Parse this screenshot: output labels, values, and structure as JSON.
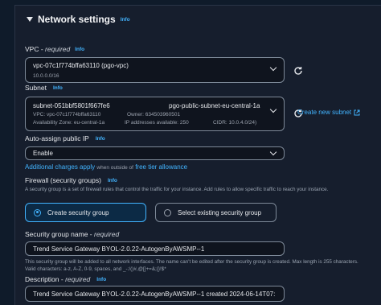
{
  "section": {
    "title": "Network settings",
    "info": "Info"
  },
  "vpc": {
    "label": "VPC",
    "required": "required",
    "info": "Info",
    "value": "vpc-07c1f774bffa63110 (pgo-vpc)",
    "cidr": "10.0.0.0/16"
  },
  "subnet": {
    "label": "Subnet",
    "info": "Info",
    "id": "subnet-051bbf5801f667fe6",
    "name": "pgo-public-subnet-eu-central-1a",
    "vpc_line": "VPC: vpc-07c1f774bffa63110",
    "owner": "Owner: 634503960501",
    "az": "Availability Zone: eu-central-1a",
    "ips": "IP addresses available: 250",
    "cidr": "CIDR: 10.0.4.0/24)",
    "create_link": "Create new subnet"
  },
  "public_ip": {
    "label": "Auto-assign public IP",
    "info": "Info",
    "value": "Enable",
    "charges_link": "Additional charges apply",
    "charges_mid": "when outside of",
    "free_tier_link": "free tier allowance"
  },
  "firewall": {
    "label": "Firewall (security groups)",
    "info": "Info",
    "help": "A security group is a set of firewall rules that control the traffic for your instance. Add rules to allow specific traffic to reach your instance.",
    "option_create": "Create security group",
    "option_existing": "Select existing security group",
    "selected": "create"
  },
  "sg_name": {
    "label": "Security group name",
    "required": "required",
    "value": "Trend Service Gateway BYOL-2.0.22-AutogenByAWSMP--1",
    "help": "This security group will be added to all network interfaces. The name can't be edited after the security group is created. Max length is 255 characters. Valid characters: a-z, A-Z, 0-9, spaces, and _-:/()#,@[]+=&;{}!$*"
  },
  "description": {
    "label": "Description",
    "required": "required",
    "info": "Info",
    "value": "Trend Service Gateway BYOL-2.0.22-AutogenByAWSMP--1 created 2024-06-14T07:"
  },
  "colors": {
    "accent": "#42b4ff",
    "panel": "#161e2d",
    "background": "#0f1b2a"
  }
}
